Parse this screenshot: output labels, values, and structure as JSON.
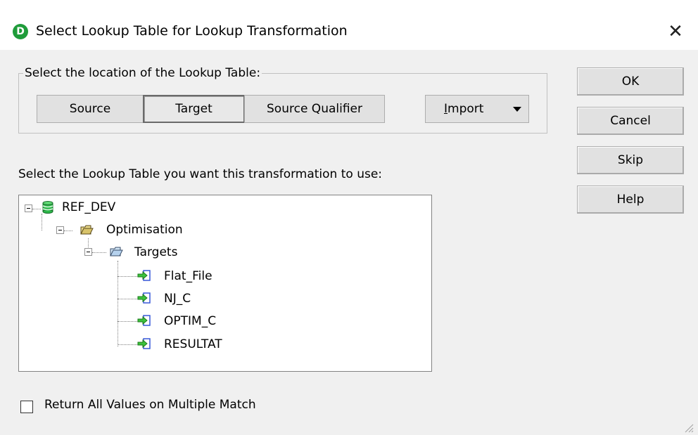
{
  "window": {
    "title": "Select Lookup Table for Lookup Transformation",
    "app_icon_glyph": "D",
    "close_glyph": "✕"
  },
  "location": {
    "legend": "Select the location of the Lookup Table:",
    "options": [
      {
        "label": "Source",
        "selected": false
      },
      {
        "label": "Target",
        "selected": true
      },
      {
        "label": "Source Qualifier",
        "selected": false
      }
    ],
    "import_label": "Import"
  },
  "buttons": {
    "ok": "OK",
    "cancel": "Cancel",
    "skip": "Skip",
    "help": "Help"
  },
  "tree": {
    "prompt": "Select the Lookup Table you want this transformation to use:",
    "repository": {
      "label": "REF_DEV",
      "icon": "database-icon"
    },
    "folder": {
      "label": "Optimisation",
      "icon": "folder-icon"
    },
    "targets": {
      "label": "Targets",
      "icon": "targets-folder-icon"
    },
    "tables": [
      {
        "label": "Flat_File",
        "icon": "target-table-icon"
      },
      {
        "label": "NJ_C",
        "icon": "target-table-icon"
      },
      {
        "label": "OPTIM_C",
        "icon": "target-table-icon"
      },
      {
        "label": "RESULTAT",
        "icon": "target-table-icon"
      }
    ]
  },
  "options": {
    "return_all_label": "Return All Values on Multiple Match",
    "return_all_checked": false
  },
  "colors": {
    "app_icon": "#1f9c3a",
    "database": "#2db84a",
    "folder": "#d8c36a",
    "target_arrow": "#3cc23c",
    "target_page": "#3858d8"
  }
}
